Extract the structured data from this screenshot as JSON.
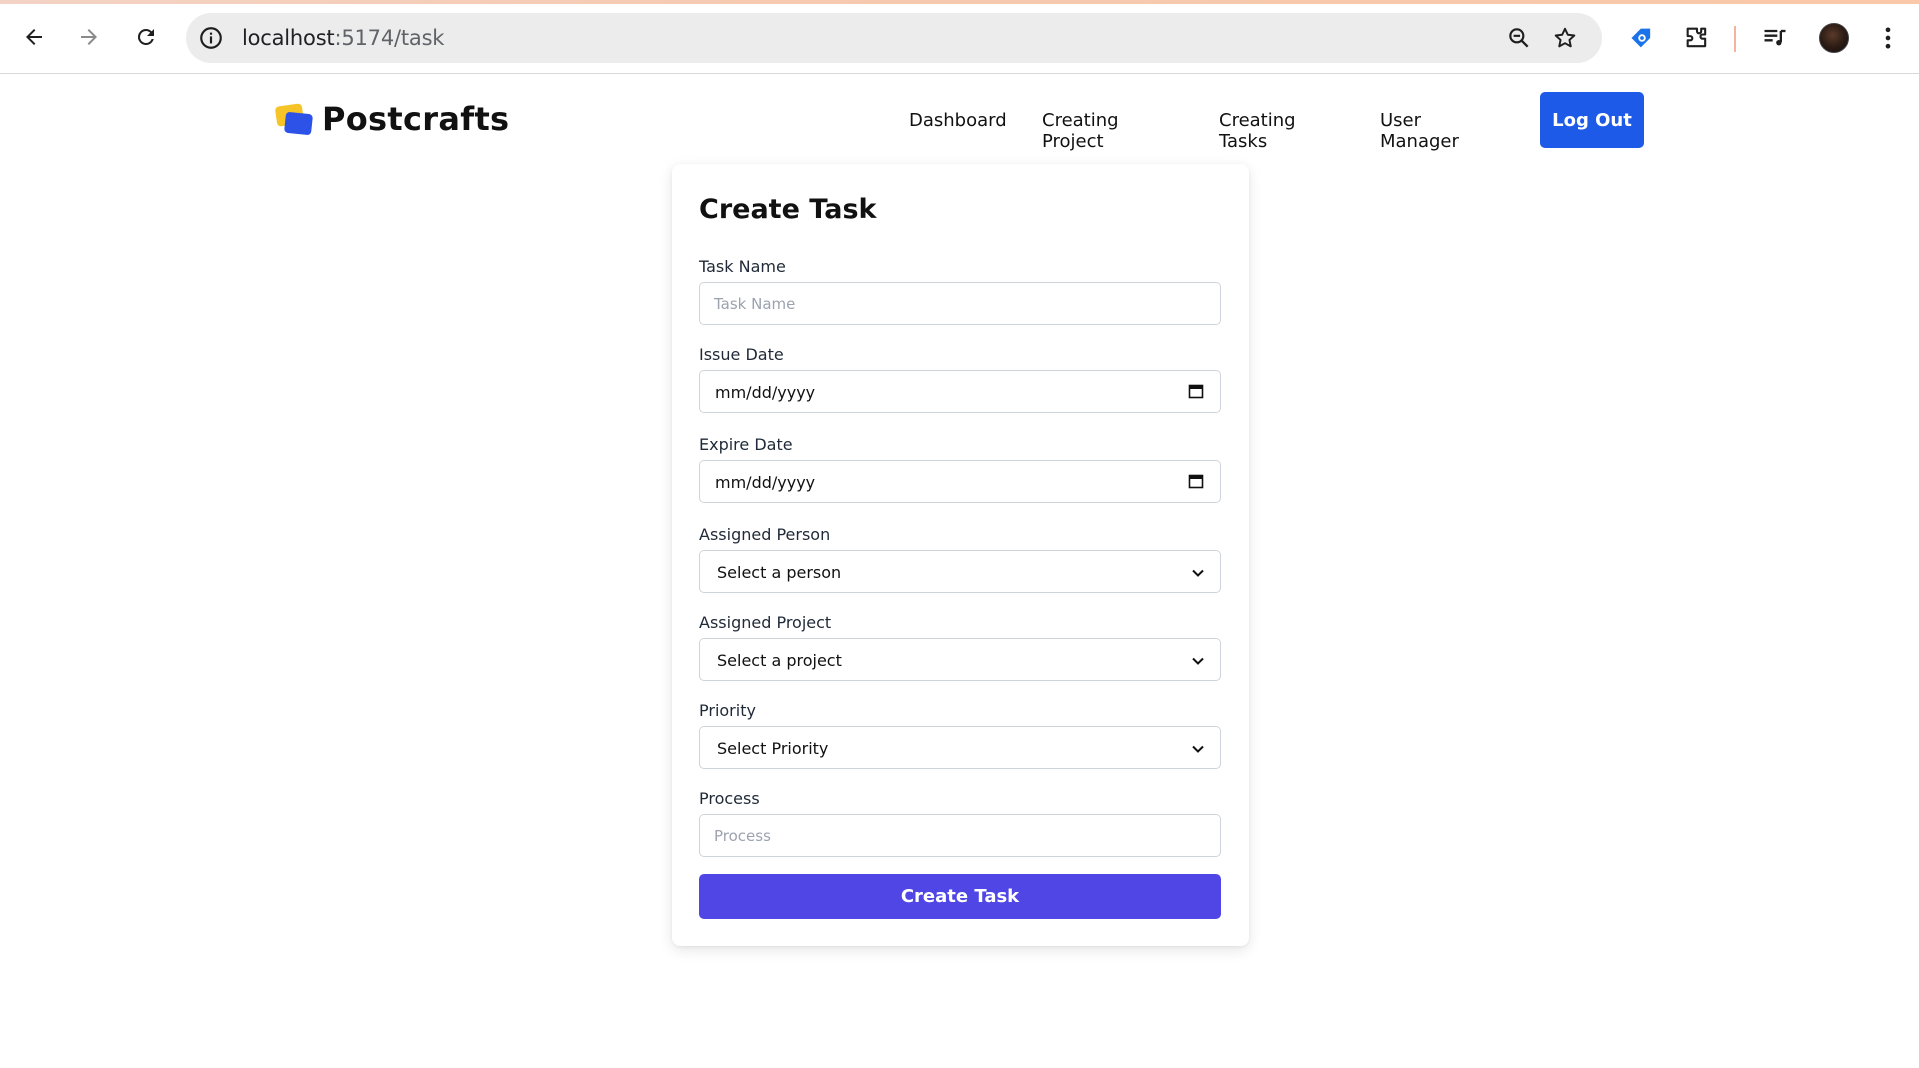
{
  "browser": {
    "url_host": "localhost",
    "url_path": ":5174/task"
  },
  "app": {
    "brand": "Postcrafts",
    "nav": [
      "Dashboard",
      "Creating Project",
      "Creating Tasks",
      "User Manager"
    ],
    "logout_label": "Log Out"
  },
  "form": {
    "title": "Create Task",
    "task_name": {
      "label": "Task Name",
      "placeholder": "Task Name"
    },
    "issue_date": {
      "label": "Issue Date",
      "value": "mm/dd/yyyy"
    },
    "expire_date": {
      "label": "Expire Date",
      "value": "mm/dd/yyyy"
    },
    "assigned_person": {
      "label": "Assigned Person",
      "selected": "Select a person"
    },
    "assigned_project": {
      "label": "Assigned Project",
      "selected": "Select a project"
    },
    "priority": {
      "label": "Priority",
      "selected": "Select Priority"
    },
    "process": {
      "label": "Process",
      "placeholder": "Process"
    },
    "submit_label": "Create Task"
  },
  "colors": {
    "logout": "#1d5ae8",
    "submit": "#4f46e5",
    "logo_yellow": "#f7c428",
    "logo_blue": "#2d52e8"
  },
  "icons": [
    "back-icon",
    "forward-icon",
    "reload-icon",
    "info-icon",
    "zoom-icon",
    "star-icon",
    "tag-extension-icon",
    "puzzle-extension-icon",
    "media-queue-icon",
    "profile-avatar",
    "kebab-menu-icon",
    "calendar-icon",
    "chevron-down-icon"
  ]
}
